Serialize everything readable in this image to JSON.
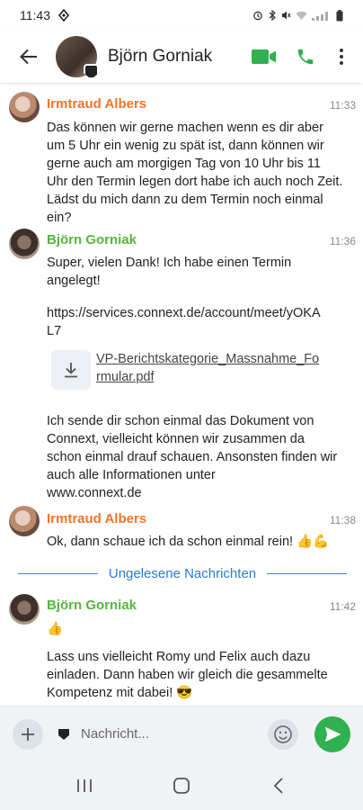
{
  "status_bar": {
    "time": "11:43"
  },
  "header": {
    "contact_name": "Björn Gorniak"
  },
  "messages": [
    {
      "sender": "Irmtraud Albers",
      "time": "11:33",
      "text": "Das können wir gerne machen wenn es dir aber um 5 Uhr ein wenig zu spät ist, dann können wir gerne auch am morgigen Tag von 10 Uhr bis 11 Uhr den Termin legen dort habe ich auch noch Zeit. Lädst du mich dann zu dem Termin noch einmal ein?"
    },
    {
      "sender": "Björn Gorniak",
      "time": "11:36",
      "text": "Super, vielen Dank! Ich habe einen Termin angelegt!",
      "link": "https://services.connext.de/account/meet/yOKAL7",
      "file_name": "VP-Berichtskategorie_Massnahme_Formular.pdf",
      "text2": "Ich sende dir schon einmal das Dokument von Connext, vielleicht können wir zusammen da schon einmal drauf schauen. Ansonsten finden wir auch alle Informationen unter",
      "link2": "www.connext.de"
    },
    {
      "sender": "Irmtraud Albers",
      "time": "11:38",
      "text": "Ok, dann schaue ich da schon einmal rein! 👍💪"
    },
    {
      "sender": "Björn Gorniak",
      "time": "11:42",
      "text": "👍",
      "text2": "Lass uns vielleicht Romy und Felix auch dazu einladen. Dann haben wir gleich die gesammelte Kompetenz mit dabei! 😎"
    }
  ],
  "divider": {
    "label": "Ungelesene Nachrichten"
  },
  "composer": {
    "placeholder": "Nachricht..."
  },
  "colors": {
    "orange_sender": "#f2742b",
    "green_sender": "#55b63a",
    "link": "#2a7bd4",
    "send": "#2eb14e",
    "call": "#2eb14e"
  },
  "icons": [
    "back-arrow-icon",
    "video-call-icon",
    "phone-icon",
    "more-vert-icon",
    "download-icon",
    "plus-icon",
    "shield-icon",
    "emoji-icon",
    "send-icon",
    "recent-apps-icon",
    "home-icon",
    "nav-back-icon"
  ]
}
